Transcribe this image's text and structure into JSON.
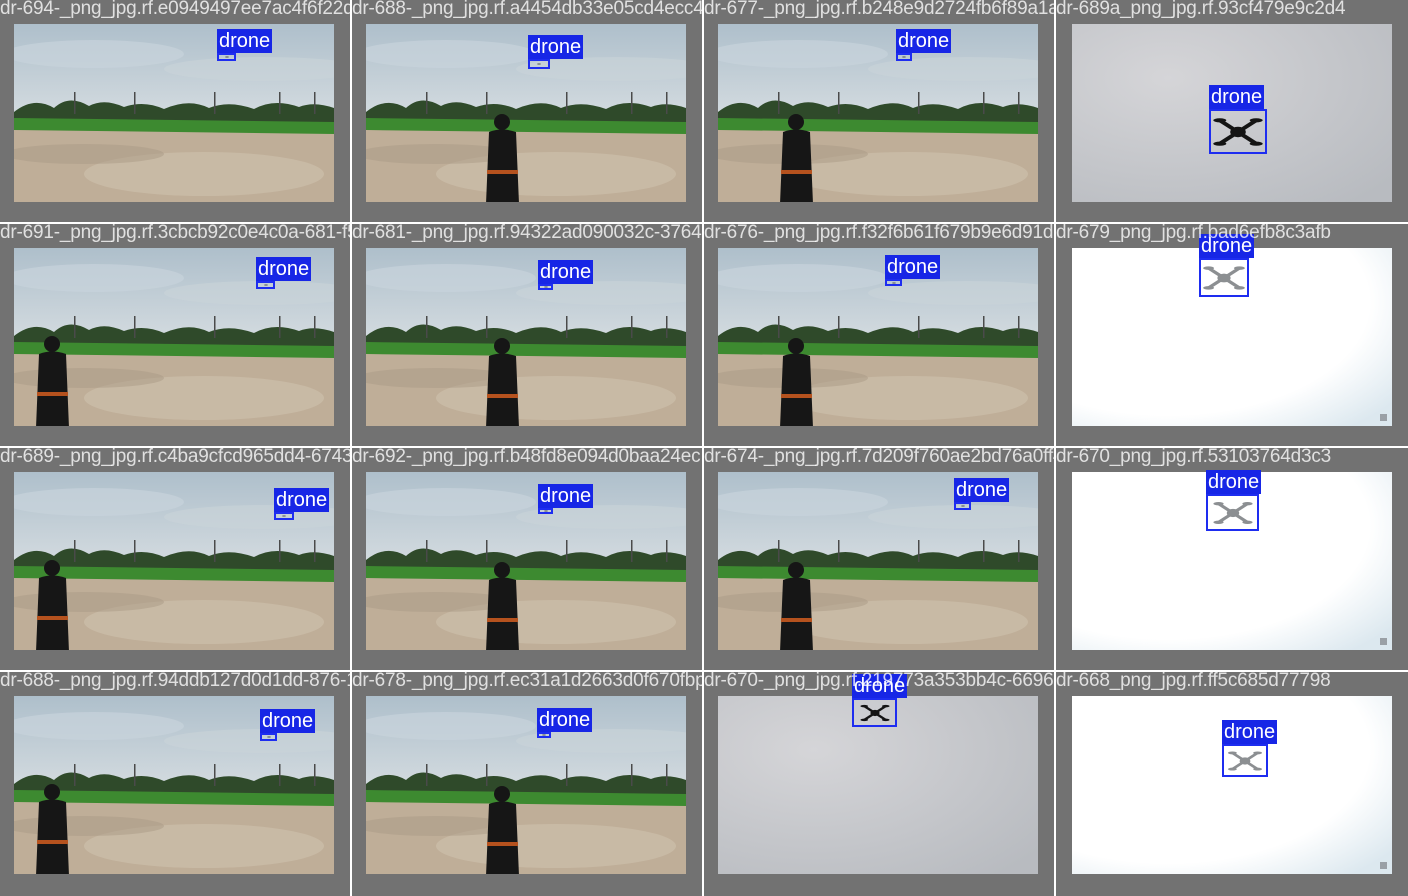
{
  "class_label": "drone",
  "colors": {
    "tile_border": "#727272",
    "box": "#1e2df0",
    "label_bg": "#1726e6",
    "label_text": "#ffffff"
  },
  "tiles": [
    {
      "filename": "dr-694-_png_jpg.rf.e0949497ee7ac4f6f22d3",
      "scene": "field-empty",
      "drone_style": "tiny"
    },
    {
      "filename": "dr-688-_png_jpg.rf.a4454db33e05cd4ecc4e4",
      "scene": "field-person-back",
      "drone_style": "tiny"
    },
    {
      "filename": "dr-677-_png_jpg.rf.b248e9d2724fb6f89a1a",
      "scene": "field-person-side",
      "drone_style": "tiny"
    },
    {
      "filename": "dr-689a_png_jpg.rf.93cf479e9c2d4",
      "scene": "sky-grey",
      "drone_style": "dark"
    },
    {
      "filename": "dr-691-_png_jpg.rf.3cbcb92c0e4c0a-681-f5",
      "scene": "field-person-walk",
      "drone_style": "tiny"
    },
    {
      "filename": "dr-681-_png_jpg.rf.94322ad090032c-376427",
      "scene": "field-person-back",
      "drone_style": "tiny"
    },
    {
      "filename": "dr-676-_png_jpg.rf.f32f6b61f679b9e6d91d0",
      "scene": "field-person-side",
      "drone_style": "tiny"
    },
    {
      "filename": "dr-679_png_jpg.rf.bad6efb8c3afb",
      "scene": "sky-white",
      "drone_style": "light"
    },
    {
      "filename": "dr-689-_png_jpg.rf.c4ba9cfcd965dd4-6743f",
      "scene": "field-person-walk",
      "drone_style": "tiny"
    },
    {
      "filename": "dr-692-_png_jpg.rf.b48fd8e094d0baa24ec",
      "scene": "field-person-back",
      "drone_style": "tiny"
    },
    {
      "filename": "dr-674-_png_jpg.rf.7d209f760ae2bd76a0ff4",
      "scene": "field-person-side",
      "drone_style": "tiny"
    },
    {
      "filename": "dr-670_png_jpg.rf.53103764d3c3",
      "scene": "sky-white",
      "drone_style": "light"
    },
    {
      "filename": "dr-688-_png_jpg.rf.94ddb127d0d1dd-876-187",
      "scene": "field-person-walk",
      "drone_style": "tiny"
    },
    {
      "filename": "dr-678-_png_jpg.rf.ec31a1d2663d0f670fbpng",
      "scene": "field-person-back",
      "drone_style": "tiny"
    },
    {
      "filename": "dr-670-_png_jpg.rf.219773a353bb4c-6696-26",
      "scene": "sky-grey",
      "drone_style": "dark"
    },
    {
      "filename": "dr-668_png_jpg.rf.ff5c685d77798",
      "scene": "sky-white",
      "drone_style": "light"
    }
  ]
}
